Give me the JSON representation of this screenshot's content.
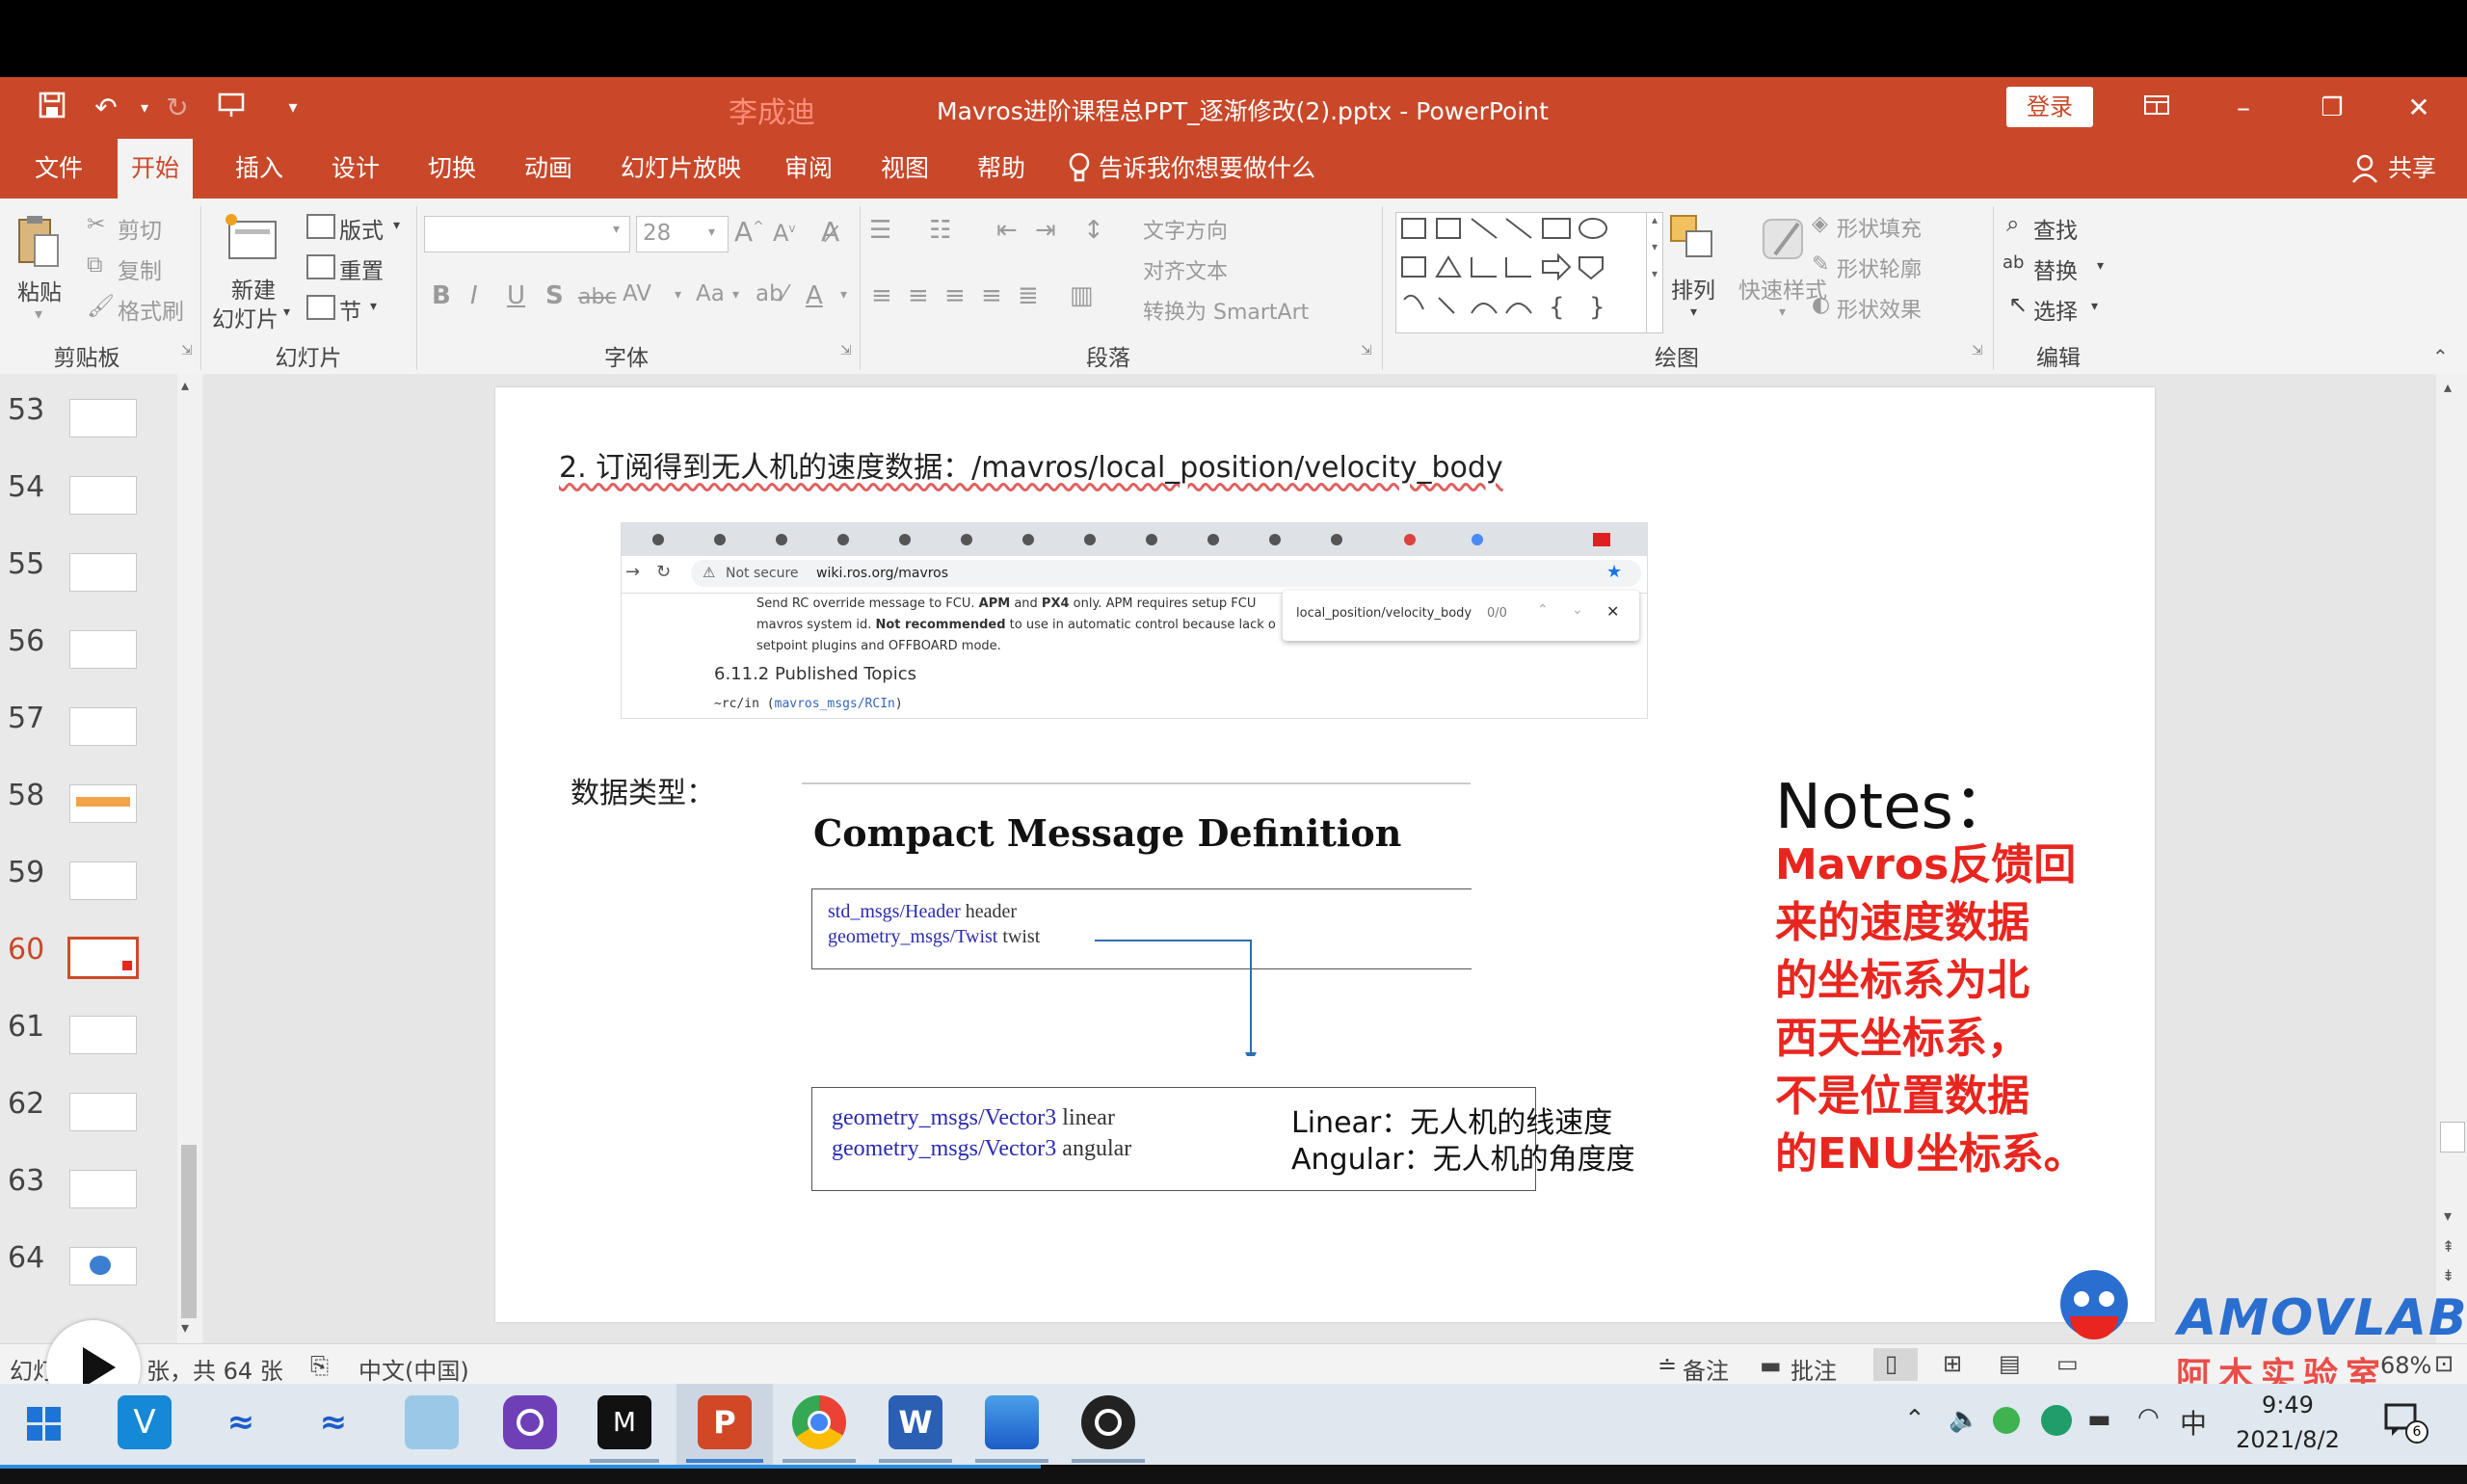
{
  "titlebar": {
    "user_name": "李成迪",
    "title": "Mavros进阶课程总PPT_逐渐修改(2).pptx  -  PowerPoint",
    "login": "登录"
  },
  "tabs": [
    "文件",
    "开始",
    "插入",
    "设计",
    "切换",
    "动画",
    "幻灯片放映",
    "审阅",
    "视图",
    "帮助"
  ],
  "tell_me": "告诉我你想要做什么",
  "share": "共享",
  "ribbon": {
    "clipboard": {
      "paste": "粘贴",
      "cut": "剪切",
      "copy": "复制",
      "format_painter": "格式刷",
      "label": "剪贴板"
    },
    "slides": {
      "new_slide_1": "新建",
      "new_slide_2": "幻灯片",
      "layout": "版式",
      "reset": "重置",
      "section": "节",
      "label": "幻灯片"
    },
    "font": {
      "font_size": "28",
      "bold": "B",
      "italic": "I",
      "underline": "U",
      "shadow": "S",
      "strike": "abc",
      "spacing": "AV",
      "case": "Aa",
      "color": "A",
      "label": "字体"
    },
    "paragraph": {
      "text_direction": "文字方向",
      "align_text": "对齐文本",
      "smartart": "转换为 SmartArt",
      "label": "段落"
    },
    "drawing": {
      "arrange": "排列",
      "quick_styles": "快速样式",
      "shape_fill": "形状填充",
      "shape_outline": "形状轮廓",
      "shape_effects": "形状效果",
      "label": "绘图"
    },
    "editing": {
      "find": "查找",
      "replace": "替换",
      "select": "选择",
      "label": "编辑"
    }
  },
  "thumbnails": [
    "53",
    "54",
    "55",
    "56",
    "57",
    "58",
    "59",
    "60",
    "61",
    "62",
    "63",
    "64"
  ],
  "selected_slide": "60",
  "slide": {
    "heading": "2. 订阅得到无人机的速度数据：/mavros/local_position/velocity_body",
    "browser": {
      "url_note": "Not secure",
      "url": "wiki.ros.org/mavros",
      "find_text": "local_position/velocity_body",
      "find_count": "0/0",
      "line1_a": "Send RC override message to FCU. ",
      "line1_b": "APM",
      "line1_c": " and ",
      "line1_d": "PX4",
      "line1_e": " only. APM requires setup FCU",
      "line2_a": "mavros system id. ",
      "line2_b": "Not recommended",
      "line2_c": " to use in automatic control because lack o",
      "line3": "setpoint plugins and OFFBOARD mode.",
      "section": "6.11.2 Published Topics",
      "topic_a": "~rc/in (",
      "topic_b": "mavros_msgs/RCIn",
      "topic_c": ")"
    },
    "data_type_label": "数据类型：",
    "compact_title": "Compact Message Definition",
    "msg1_type": "std_msgs/Header",
    "msg1_name": " header",
    "msg2_type": "geometry_msgs/Twist",
    "msg2_name": " twist",
    "vec1_type": "geometry_msgs/Vector3",
    "vec1_name": " linear",
    "vec2_type": "geometry_msgs/Vector3",
    "vec2_name": " angular",
    "linear_note": "Linear：无人机的线速度",
    "angular_note": "Angular：无人机的角度度",
    "notes_title": "Notes：",
    "notes_lines": [
      "Mavros反馈回",
      "来的速度数据",
      "的坐标系为北",
      "西天坐标系，",
      "不是位置数据",
      "的ENU坐标系。"
    ]
  },
  "watermark": {
    "brand": "AMOVLAB",
    "sub": "阿木实验室"
  },
  "status": {
    "slide_info_a": "幻灯",
    "slide_info_b": "张，共 64 张",
    "language": "中文(中国)",
    "notes": "备注",
    "comments": "批注",
    "zoom": "68%"
  },
  "taskbar": {
    "time": "9:49",
    "date": "2021/8/2",
    "ime": "中",
    "notif_count": "6"
  },
  "colors": {
    "accent": "#c9482a",
    "notes_red": "#e8261f",
    "link": "#2b2bb0"
  }
}
